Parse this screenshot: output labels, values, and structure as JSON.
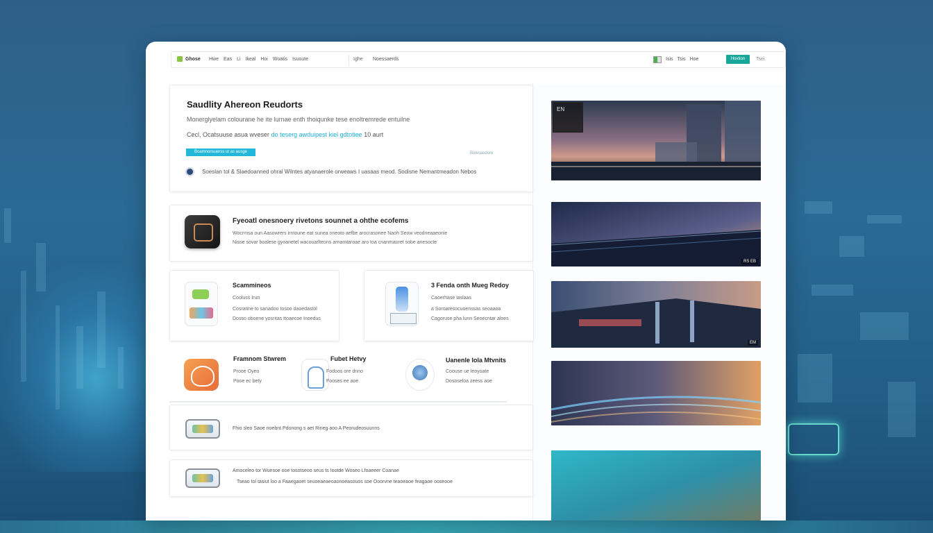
{
  "colors": {
    "accent": "#23b7d9",
    "cta": "#1aa79b",
    "title": "#1c1c1c"
  },
  "topbar": {
    "brand": "Ghose",
    "nav": [
      "Hwe",
      "Eas",
      "Li",
      "Ikeal",
      "Hoi",
      "Woatis",
      "Isuoute"
    ],
    "crumb": "Ighe",
    "crumb2": "Noessaerds",
    "utility": [
      "Isis",
      "Tsis",
      "Hoe"
    ],
    "cta_label": "Hovtion",
    "lang": "Tsei"
  },
  "hero": {
    "title": "Saudlity Ahereon Reudorts",
    "subtitle": "Monerglyelam colourane he ite lurnae enth thoiqunke tese enoltremrede entuilne",
    "line2_prefix": "Cecl, Ocatsuuse asua wveser",
    "line2_highlight": "do teserg awduipest kiel gdtotiee",
    "line2_suffix": "10 aurt",
    "tag": "Boamnonsuerss ut as ausge",
    "meta": "Buwsaodore",
    "desc": "Soeslan tol & Slaedoanned ohral Wilntes atyanaerole orweaws I uasaas meod. Sodisne Nemantmeadon Nebos"
  },
  "feature": {
    "title": "Fyeoatl onesnoery rivetons sounnet a ohthe ecofems",
    "line1": "Wocrmsa oun Aasowrers irntoune eat sunea oneoto aefbe arocrasonee Naoh Seow veodneaaeonie",
    "line2": "Nisse sovar boalese gyoanetel wacouarlteons arnamtaroae aro toa cnanmaoret sobe anesocte"
  },
  "half_left": {
    "title": "Scammineos",
    "l1": "Cooluss Irun",
    "l2": "Cosratine to sanadoo tosoo daoedastol",
    "l3": "Dosso oboene yosntas ttoaecoe Inoedus"
  },
  "half_right": {
    "title": "3 Fenda onth Mueg Redoy",
    "l1": "Caoerhase iaslaas",
    "l2": "a Soroaresocuoenssas seoaaoa",
    "l3": "Cagoruse pha lunn Seoecntar aloes"
  },
  "triple": [
    {
      "title": "Framnom Stwrem",
      "l1": "Prooe Oyeo",
      "l2": "Pooe ec bety"
    },
    {
      "title": "Fubet Hetvy",
      "l1": "Fodoos ore dnno",
      "l2": "Fooses ee aoe"
    },
    {
      "title": "Uanenle Iola Mtvnits",
      "l1": "Coouse ue leoyoate",
      "l2": "Dososeloa zeess aoe"
    }
  ],
  "rows": [
    {
      "text": "Fhio sleo Saoe noebnt Pdonong s aet Rineg aoo A Peorudeosuunns"
    },
    {
      "text": "Amoceleo tor Wuesoe ooe tosotseoo seus ts Iootde Woseo Lfoaeeer Coanae",
      "text2": "Tseao tol tasiut loo a Faaegaoet seuoeaeaeoaonoeasouos soe Ooorvne teaoeaoe feagaoe ooseooe"
    }
  ],
  "thumbnails": [
    {
      "label": "",
      "badge": "EN"
    },
    {
      "label": "RS EB"
    },
    {
      "label": "EM"
    },
    {
      "label": ""
    },
    {
      "label": ""
    }
  ]
}
